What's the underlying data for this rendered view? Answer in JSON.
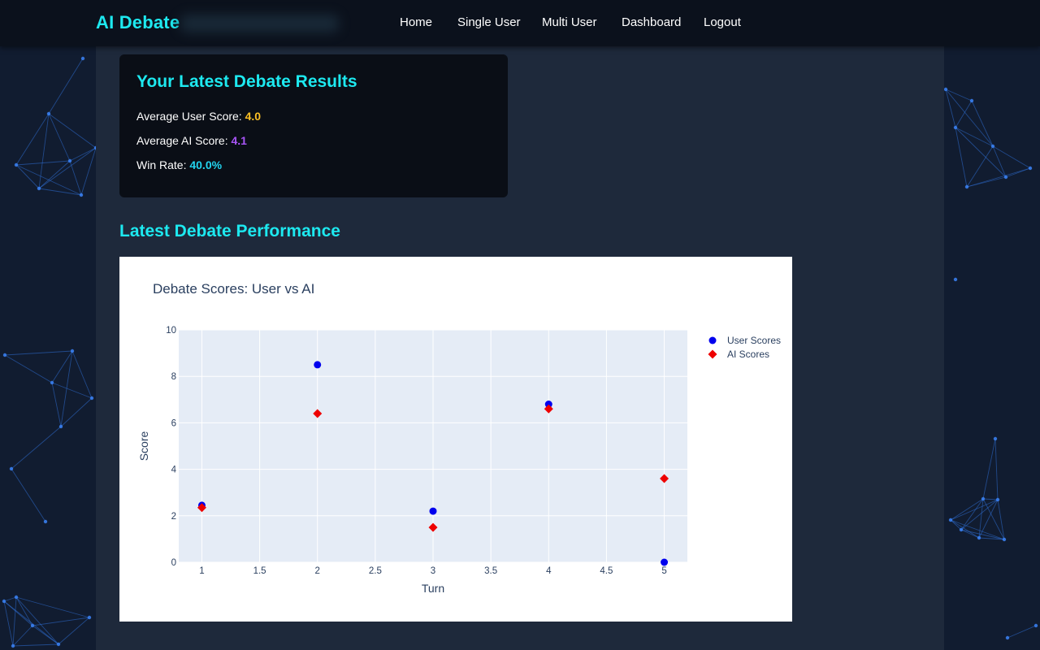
{
  "navbar": {
    "brand": "AI Debate",
    "links": [
      "Home",
      "Single User",
      "Multi User",
      "Dashboard",
      "Logout"
    ]
  },
  "results": {
    "title": "Your Latest Debate Results",
    "avg_user_label": "Average User Score:",
    "avg_user_value": "4.0",
    "avg_ai_label": "Average AI Score:",
    "avg_ai_value": "4.1",
    "win_rate_label": "Win Rate:",
    "win_rate_value": "40.0%"
  },
  "performance": {
    "title": "Latest Debate Performance"
  },
  "colors": {
    "accent": "#1de9f0",
    "user_score": "#fbbf24",
    "ai_score": "#a855f7",
    "win_rate": "#22d3ee",
    "user_series": "#0000ee",
    "ai_series": "#ee0000",
    "plot_bg": "#e5ecf6"
  },
  "chart_data": {
    "type": "scatter",
    "title": "Debate Scores: User vs AI",
    "xlabel": "Turn",
    "ylabel": "Score",
    "xlim": [
      0.8,
      5.2
    ],
    "ylim": [
      0,
      10
    ],
    "xticks": [
      1,
      1.5,
      2,
      2.5,
      3,
      3.5,
      4,
      4.5,
      5
    ],
    "yticks": [
      0,
      2,
      4,
      6,
      8,
      10
    ],
    "grid": true,
    "legend_position": "top-right",
    "series": [
      {
        "name": "User Scores",
        "marker": "circle",
        "x": [
          1,
          2,
          3,
          4,
          5
        ],
        "y": [
          2.45,
          8.5,
          2.2,
          6.8,
          0
        ]
      },
      {
        "name": "AI Scores",
        "marker": "diamond",
        "x": [
          1,
          2,
          3,
          4,
          5
        ],
        "y": [
          2.35,
          6.4,
          1.5,
          6.6,
          3.6
        ]
      }
    ]
  }
}
